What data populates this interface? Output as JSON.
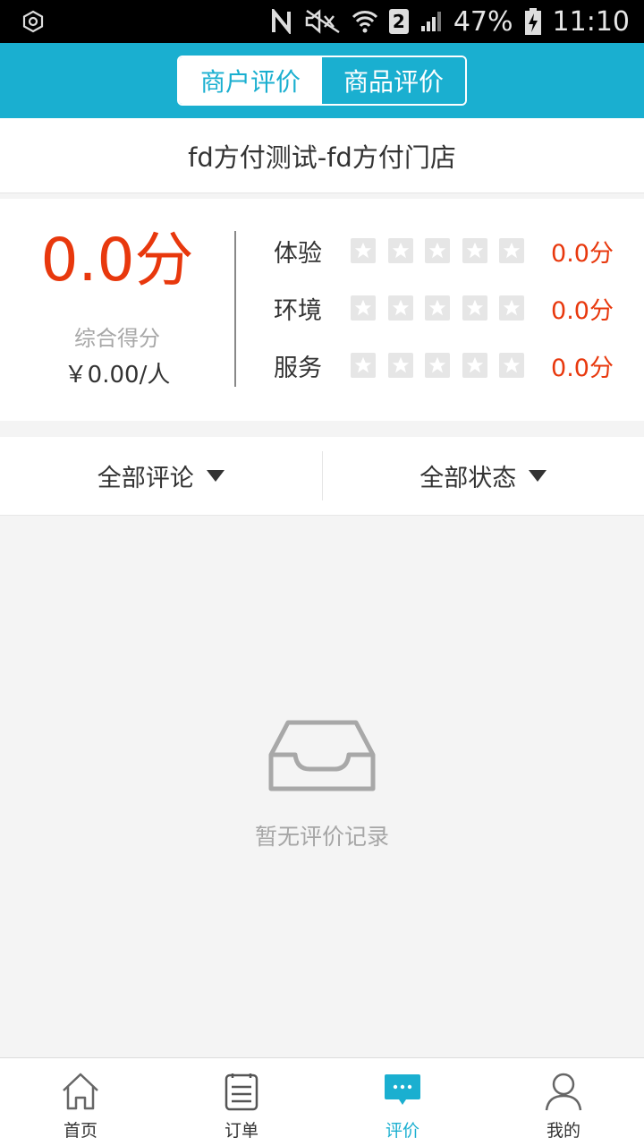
{
  "status_bar": {
    "battery": "47%",
    "time": "11:10",
    "sim": "2"
  },
  "header": {
    "tabs": [
      {
        "label": "商户评价",
        "active": true
      },
      {
        "label": "商品评价",
        "active": false
      }
    ]
  },
  "store": {
    "name": "fd方付测试-fd方付门店"
  },
  "score": {
    "overall": "0.0分",
    "overall_label": "综合得分",
    "per_person": "￥0.00/人",
    "ratings": [
      {
        "name": "体验",
        "value": "0.0分",
        "stars": 0
      },
      {
        "name": "环境",
        "value": "0.0分",
        "stars": 0
      },
      {
        "name": "服务",
        "value": "0.0分",
        "stars": 0
      }
    ]
  },
  "filters": {
    "comments": "全部评论",
    "status": "全部状态"
  },
  "empty": {
    "text": "暂无评价记录"
  },
  "tabbar": {
    "items": [
      {
        "label": "首页",
        "icon": "home-icon"
      },
      {
        "label": "订单",
        "icon": "order-icon"
      },
      {
        "label": "评价",
        "icon": "comment-icon",
        "active": true
      },
      {
        "label": "我的",
        "icon": "user-icon"
      }
    ]
  },
  "colors": {
    "accent": "#1aafd0",
    "score": "#e8380d"
  }
}
